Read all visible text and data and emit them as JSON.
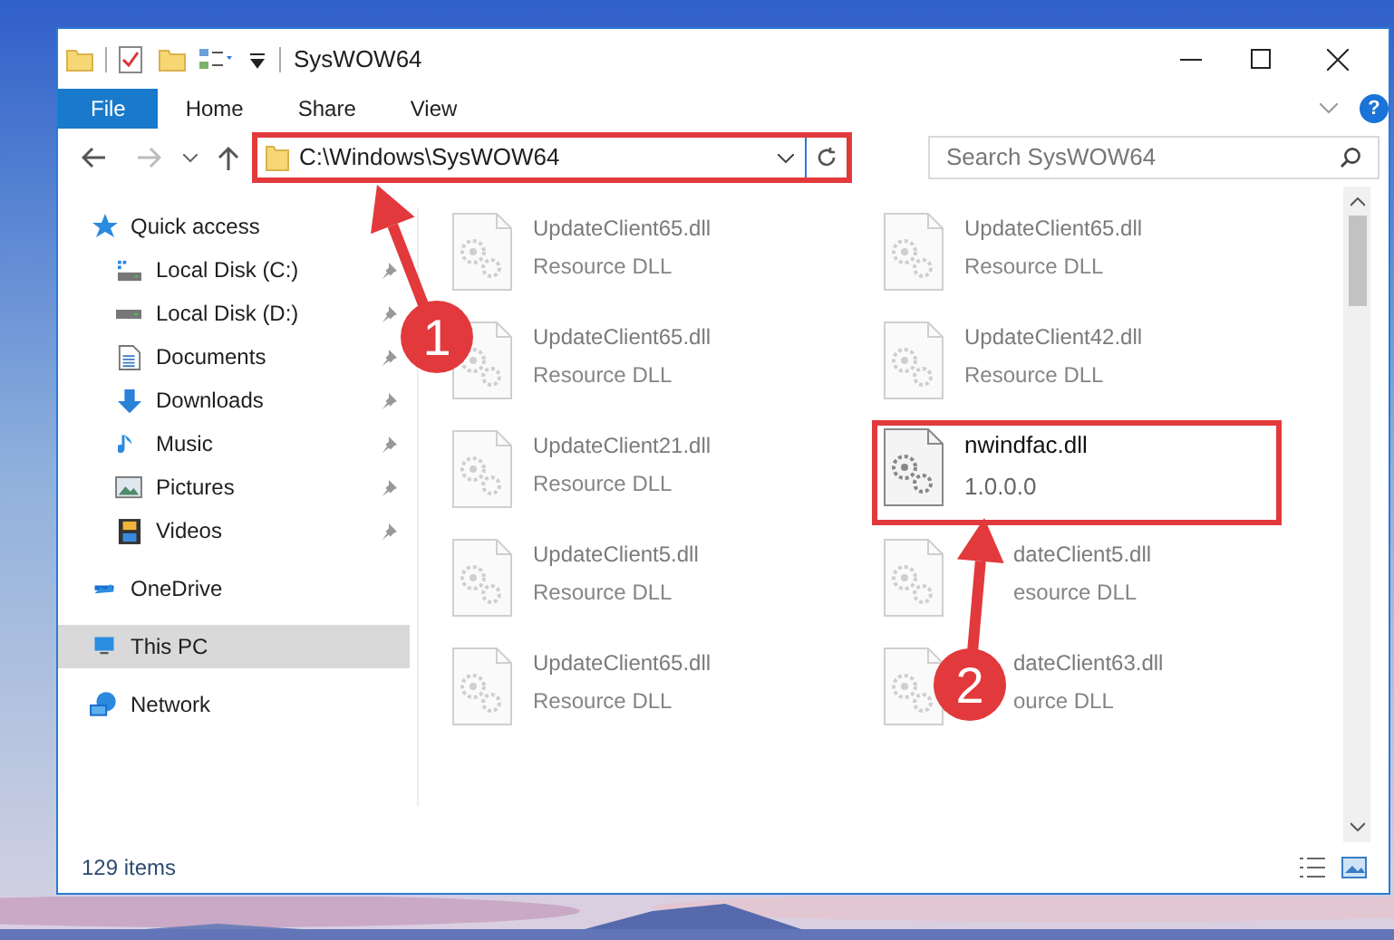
{
  "window": {
    "title": "SysWOW64"
  },
  "ribbon": {
    "tabs": [
      {
        "label": "File",
        "selected": true
      },
      {
        "label": "Home",
        "selected": false
      },
      {
        "label": "Share",
        "selected": false
      },
      {
        "label": "View",
        "selected": false
      }
    ],
    "help": "?"
  },
  "address_bar": {
    "path": "C:\\Windows\\SysWOW64",
    "highlighted": true
  },
  "search": {
    "placeholder": "Search SysWOW64"
  },
  "sidebar": {
    "items": [
      {
        "label": "Quick access",
        "selected": false,
        "children": [
          {
            "label": "Local Disk (C:)",
            "pinned": true
          },
          {
            "label": "Local Disk (D:)",
            "pinned": true
          },
          {
            "label": "Documents",
            "pinned": true
          },
          {
            "label": "Downloads",
            "pinned": true
          },
          {
            "label": "Music",
            "pinned": true
          },
          {
            "label": "Pictures",
            "pinned": true
          },
          {
            "label": "Videos",
            "pinned": true
          }
        ]
      },
      {
        "label": "OneDrive",
        "selected": false
      },
      {
        "label": "This PC",
        "selected": true
      },
      {
        "label": "Network",
        "selected": false
      }
    ]
  },
  "files": [
    {
      "name": "UpdateClient65.dll",
      "detail": "Resource DLL",
      "blurred": true,
      "highlighted": false
    },
    {
      "name": "UpdateClient65.dll",
      "detail": "Resource DLL",
      "blurred": true,
      "highlighted": false
    },
    {
      "name": "UpdateClient65.dll",
      "detail": "Resource DLL",
      "blurred": true,
      "highlighted": false
    },
    {
      "name": "UpdateClient42.dll",
      "detail": "Resource DLL",
      "blurred": true,
      "highlighted": false
    },
    {
      "name": "UpdateClient21.dll",
      "detail": "Resource DLL",
      "blurred": true,
      "highlighted": false
    },
    {
      "name": "nwindfac.dll",
      "detail": "1.0.0.0",
      "blurred": false,
      "highlighted": true
    },
    {
      "name": "UpdateClient5.dll",
      "detail": "Resource DLL",
      "blurred": true,
      "highlighted": false
    },
    {
      "name": "dateClient5.dll",
      "detail": "esource DLL",
      "blurred": true,
      "highlighted": false,
      "covered": true
    },
    {
      "name": "UpdateClient65.dll",
      "detail": "Resource DLL",
      "blurred": true,
      "highlighted": false
    },
    {
      "name": "dateClient63.dll",
      "detail": "ource DLL",
      "blurred": true,
      "highlighted": false,
      "covered": true
    }
  ],
  "status_bar": {
    "count": "129 items"
  },
  "annotations": [
    {
      "number": "1"
    },
    {
      "number": "2"
    }
  ]
}
